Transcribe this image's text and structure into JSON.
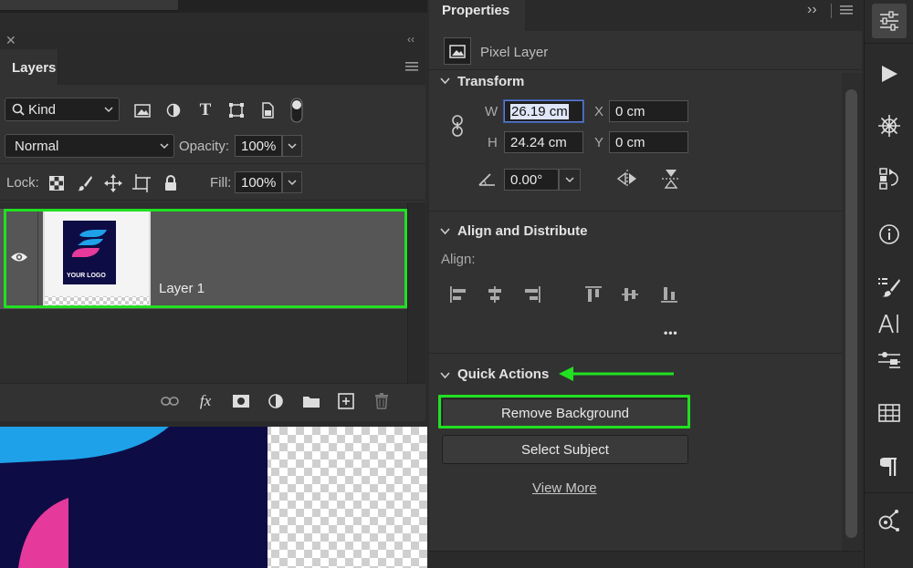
{
  "layers_panel": {
    "tab_title": "Layers",
    "filter_select": "Kind",
    "blend_mode": "Normal",
    "opacity_label": "Opacity:",
    "opacity_value": "100%",
    "lock_label": "Lock:",
    "fill_label": "Fill:",
    "fill_value": "100%",
    "layer": {
      "name": "Layer 1",
      "thumbnail_text": "YOUR LOGO"
    }
  },
  "properties_panel": {
    "tab_title": "Properties",
    "layer_type": "Pixel Layer",
    "transform": {
      "title": "Transform",
      "w_label": "W",
      "w_value": "26.19 cm",
      "h_label": "H",
      "h_value": "24.24 cm",
      "x_label": "X",
      "x_value": "0 cm",
      "y_label": "Y",
      "y_value": "0 cm",
      "angle_value": "0.00°"
    },
    "align": {
      "title": "Align and Distribute",
      "align_label": "Align:",
      "more": "•••"
    },
    "quick_actions": {
      "title": "Quick Actions",
      "remove_background": "Remove Background",
      "select_subject": "Select Subject",
      "view_more": "View More"
    }
  },
  "colors": {
    "highlight_green": "#21e021",
    "logo_navy": "#0e0c45",
    "logo_pink": "#e5399b",
    "logo_blue": "#1ea1e8"
  }
}
